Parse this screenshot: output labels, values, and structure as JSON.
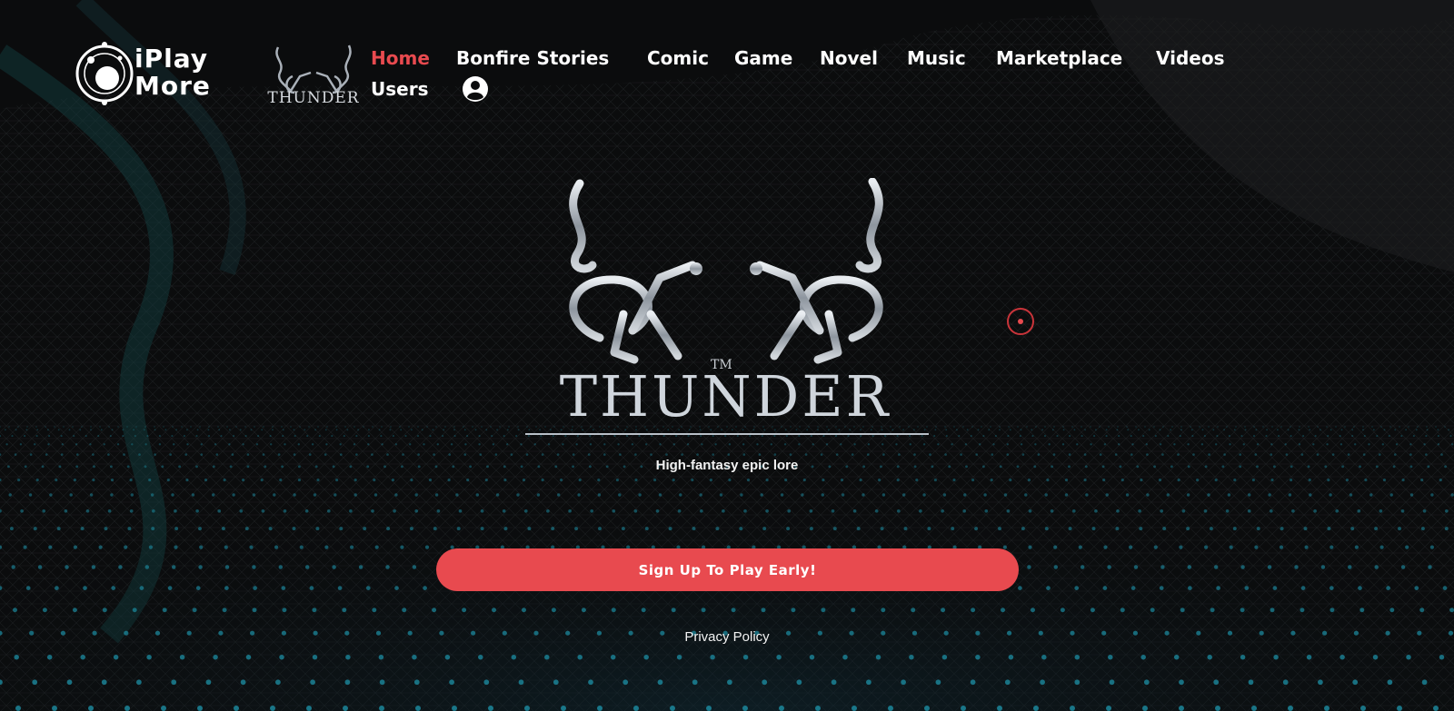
{
  "brand": {
    "name_line1": "iPlay",
    "name_line2": "More",
    "game_logo_text": "THUNDER"
  },
  "nav": {
    "items": [
      {
        "label": "Home",
        "active": true
      },
      {
        "label": "Bonfire Stories",
        "active": false
      },
      {
        "label": "Comic",
        "active": false
      },
      {
        "label": "Game",
        "active": false
      },
      {
        "label": "Novel",
        "active": false
      },
      {
        "label": "Music",
        "active": false
      },
      {
        "label": "Marketplace",
        "active": false
      },
      {
        "label": "Videos",
        "active": false
      },
      {
        "label": "Users",
        "active": false
      }
    ],
    "user_icon": "account-circle-icon"
  },
  "hero": {
    "logo_text": "THUNDER",
    "trademark": "TM",
    "tagline": "High-fantasy epic lore"
  },
  "cta": {
    "signup_label": "Sign Up To Play Early!"
  },
  "footer": {
    "privacy_label": "Privacy Policy"
  },
  "colors": {
    "accent": "#e84a4f",
    "background": "#0b0c0d",
    "text": "#ffffff",
    "mesh_teal": "#1f9fb8"
  }
}
